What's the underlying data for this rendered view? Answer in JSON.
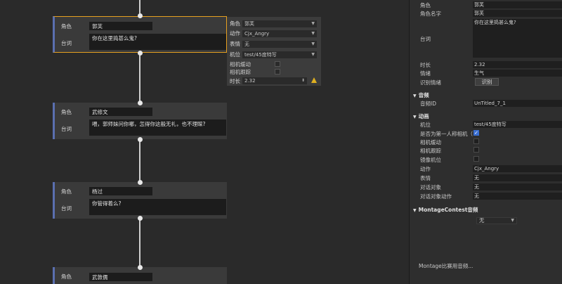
{
  "nodes": [
    {
      "role_label": "角色",
      "role_value": "郭芙",
      "line_label": "台词",
      "line_value": "你在这里捣甚么鬼?"
    },
    {
      "role_label": "角色",
      "role_value": "武修文",
      "line_label": "台词",
      "line_value": "喂，郭师妹问你哪，怎得你这般无礼，也不理睬?"
    },
    {
      "role_label": "角色",
      "role_value": "杨过",
      "line_label": "台词",
      "line_value": "你管得着么?"
    },
    {
      "role_label": "角色",
      "role_value": "武敦儒"
    }
  ],
  "side_panel": {
    "role_label": "角色",
    "role_value": "郭芙",
    "action_label": "动作",
    "action_value": "Cjx_Angry",
    "expression_label": "表情",
    "expression_value": "无",
    "camera_label": "机位",
    "camera_value": "test/45度特写",
    "camera_move_label": "相机缓动",
    "camera_follow_label": "相机跟踪",
    "duration_label": "时长",
    "duration_value": "2.32",
    "warning_icon": "warning-icon"
  },
  "props": {
    "role_label": "角色",
    "role_value": "郭芙",
    "role_name_label": "角色名字",
    "role_name_value": "郭芙",
    "line_label": "台词",
    "line_value": "你在这里捣甚么鬼?",
    "duration_label": "时长",
    "duration_value": "2.32",
    "emotion_label": "情绪",
    "emotion_value": "生气",
    "recognize_label": "识别情绪",
    "recognize_button": "识别",
    "audio_section": "音频",
    "audio_id_label": "音频ID",
    "audio_id_value": "UnTitled_7_1",
    "anim_section": "动画",
    "camera_label": "机位",
    "camera_value": "test/45度特写",
    "first_person_label": "是否为第一人称相机（",
    "camera_move_label": "相机缓动",
    "camera_follow_label": "相机跟踪",
    "mirror_label": "镜像机位",
    "action_label": "动作",
    "action_value": "Cjx_Angry",
    "expression_label": "表情",
    "expression_value": "无",
    "target_label": "对话对象",
    "target_value": "无",
    "target_action_label": "对话对象动作",
    "target_action_value": "无",
    "montage_section": "MontageContest音频",
    "montage_dropdown": "无",
    "montage_footer": "Montage比赛用音频..."
  }
}
